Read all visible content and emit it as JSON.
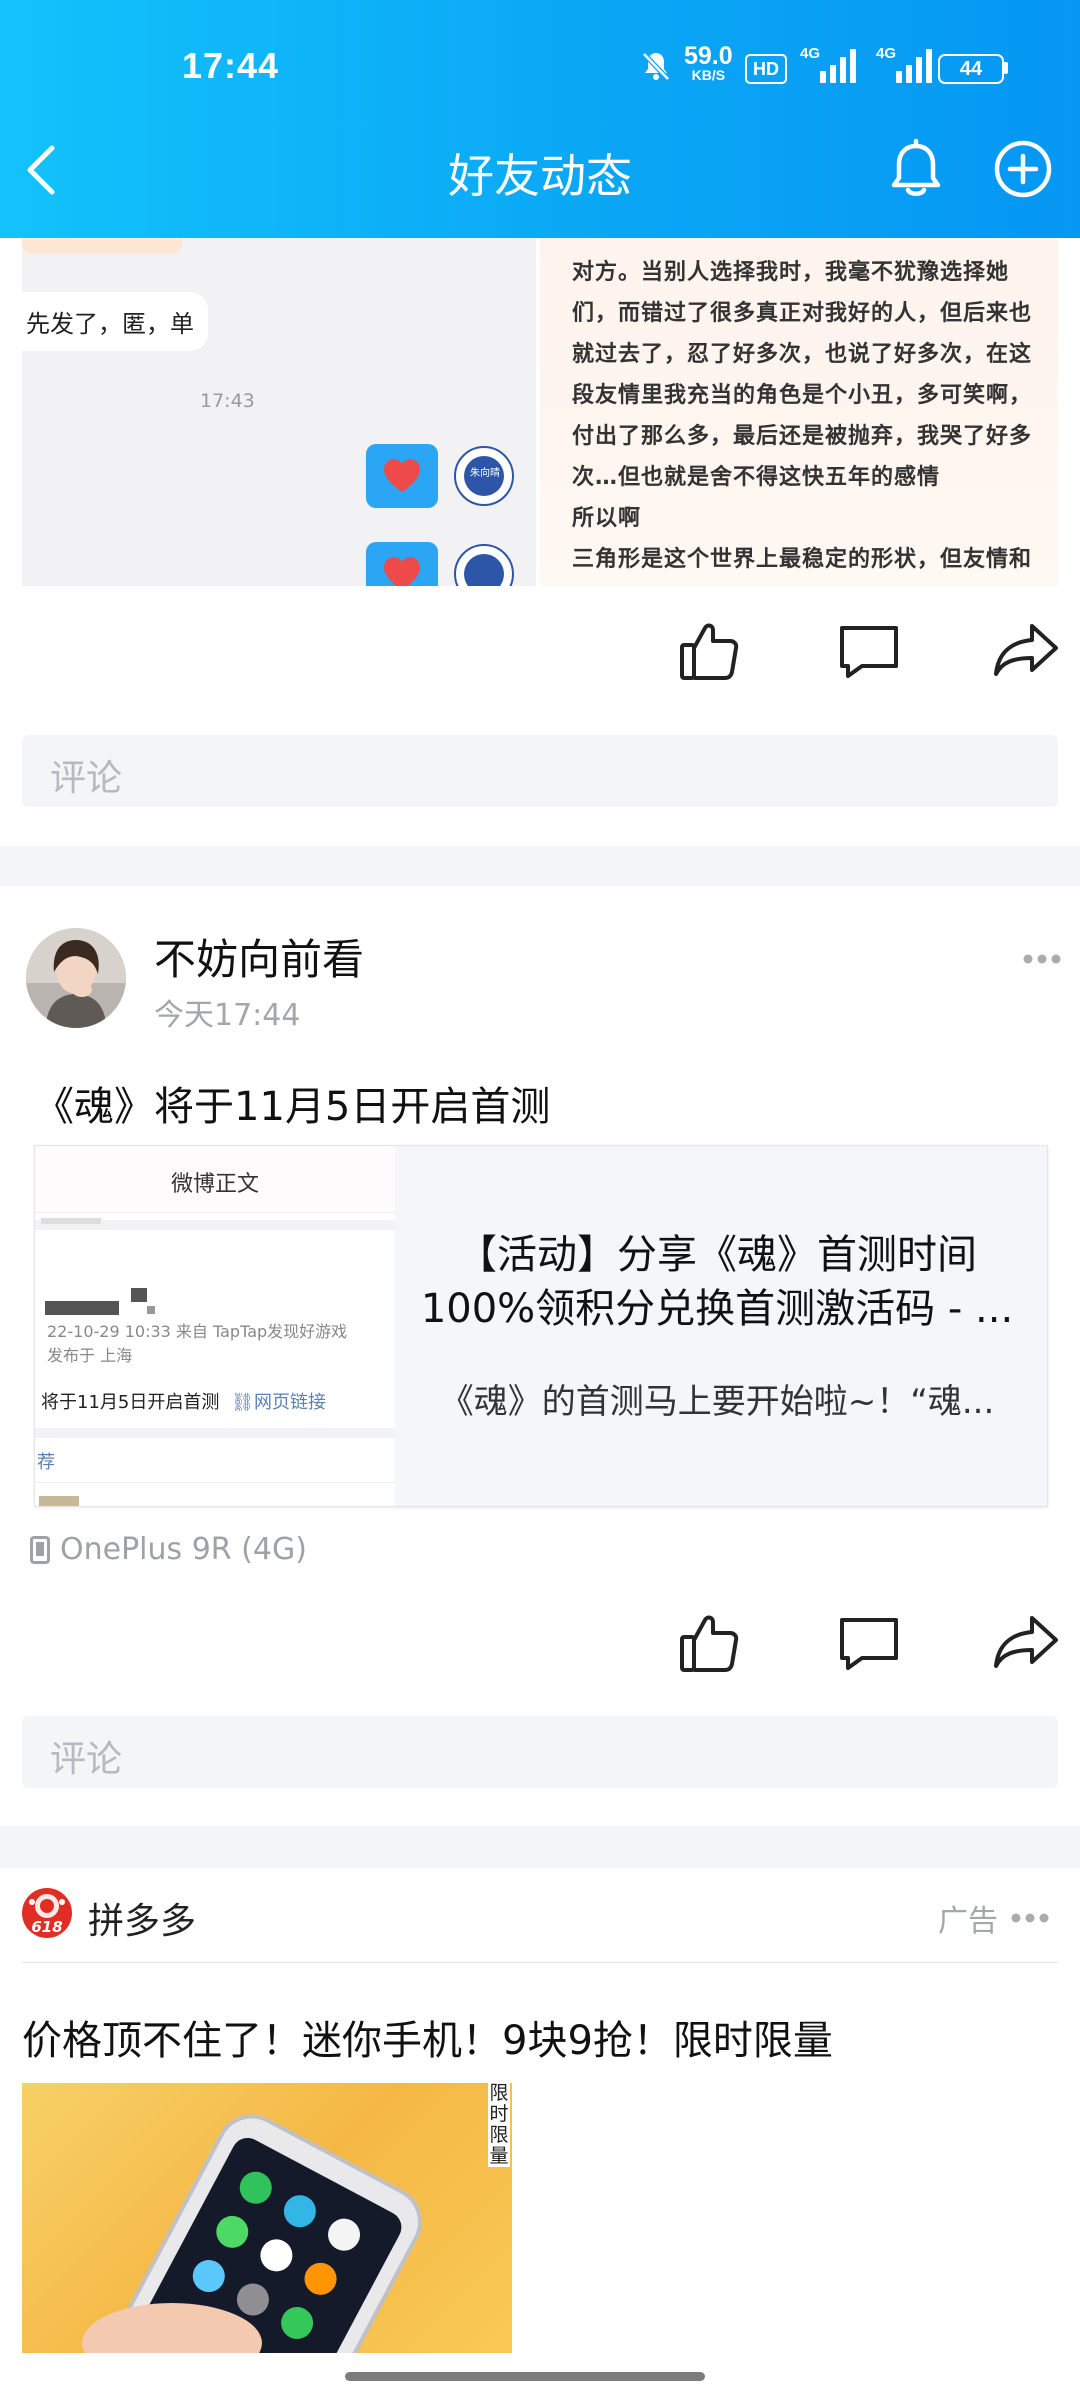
{
  "status_bar": {
    "time": "17:44",
    "net_speed": "59.0",
    "net_unit": "KB/S",
    "hd": "HD",
    "sim1": "4G",
    "sim2": "4G",
    "battery": "44"
  },
  "header": {
    "title": "好友动态"
  },
  "post1": {
    "chat_message": "先发了，匿，单",
    "chat_time": "17:43",
    "avatar_text": "朱向晴",
    "poem_lines": [
      "对方。当别人选择我时，我毫不犹豫选择她",
      "们，而错过了很多真正对我好的人，但后来也",
      "就过去了，忍了好多次，也说了好多次，在这",
      "段友情里我充当的角色是个小丑，多可笑啊，",
      "付出了那么多，最后还是被抛弃，我哭了好多",
      "次…但也就是舍不得这快五年的感情",
      "所以啊",
      "三角形是这个世界上最稳定的形状，但友情和"
    ],
    "comment_placeholder": "评论"
  },
  "post2": {
    "author": "不妨向前看",
    "time": "今天17:44",
    "text": "《魂》将于11月5日开启首测",
    "link": {
      "thumb_header": "微博正文",
      "thumb_meta_line1": "22-10-29 10:33  来自 TapTap发现好游戏",
      "thumb_meta_line2": "发布于 上海",
      "thumb_body": "将于11月5日开启首测",
      "thumb_link": "网页链接",
      "thumb_tail": "荐",
      "title_line1": "【活动】分享《魂》首测时间",
      "title_line2": "100%领积分兑换首测激活码 - ...",
      "summary": "《魂》的首测马上要开始啦~！“魂..."
    },
    "device": "OnePlus 9R (4G)",
    "comment_placeholder": "评论"
  },
  "ad": {
    "brand": "拼多多",
    "brand_badge": "618",
    "ad_label": "广告",
    "headline": "价格顶不住了！迷你手机！9块9抢！限时限量",
    "image_vertical_text": "限时限量"
  },
  "colors": {
    "header_start": "#13c2fb",
    "header_end": "#0697f3",
    "heart_bubble": "#2aa6f5",
    "heart": "#ef4a4a",
    "pdd_red": "#e02e24"
  }
}
